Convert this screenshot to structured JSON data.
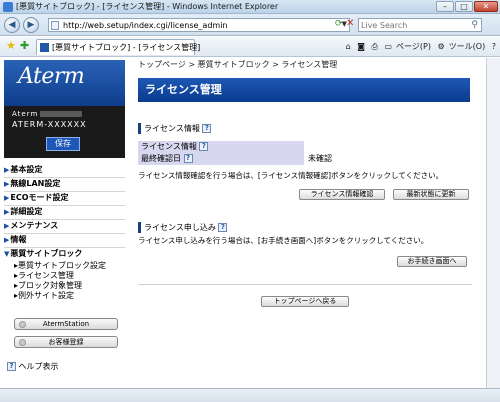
{
  "window": {
    "title": "[悪質サイトブロック] - [ライセンス管理] - Windows Internet Explorer",
    "min_symbol": "–",
    "max_symbol": "□",
    "close_symbol": "✕"
  },
  "address": {
    "url": "http://web.setup/index.cgi/license_admin",
    "search_placeholder": "Live Search"
  },
  "tab": {
    "label": "[悪質サイトブロック] - [ライセンス管理]"
  },
  "ie_toolbar": {
    "page_label": "ページ(P)",
    "tools_label": "ツール(O)"
  },
  "sidebar": {
    "logo": "Aterm",
    "model_prefix": "Aterm",
    "model_name": "ATERM-XXXXXX",
    "save_label": "保存",
    "menu": [
      {
        "label": "基本設定"
      },
      {
        "label": "無線LAN設定"
      },
      {
        "label": "ECOモード設定"
      },
      {
        "label": "詳細設定"
      },
      {
        "label": "メンテナンス"
      },
      {
        "label": "情報"
      },
      {
        "label": "悪質サイトブロック"
      }
    ],
    "submenu": [
      {
        "label": "悪質サイトブロック設定"
      },
      {
        "label": "ライセンス管理"
      },
      {
        "label": "ブロック対象管理"
      },
      {
        "label": "例外サイト設定"
      }
    ],
    "aterm_station_label": "AtermStation",
    "register_label": "お客様登録",
    "help_label": "ヘルプ表示"
  },
  "main": {
    "breadcrumb": "トップページ > 悪質サイトブロック > ライセンス管理",
    "title": "ライセンス管理",
    "license_section": "ライセンス情報",
    "rows": [
      {
        "label": "ライセンス情報",
        "value": ""
      },
      {
        "label": "最終確認日",
        "value": "未確認"
      }
    ],
    "license_desc": "ライセンス情報確認を行う場合は、[ライセンス情報確認]ボタンをクリックしてください。",
    "btn_check": "ライセンス情報確認",
    "btn_refresh": "最新状態に更新",
    "apply_section": "ライセンス申し込み",
    "apply_desc": "ライセンス申し込みを行う場合は、[お手続き画面へ]ボタンをクリックしてください。",
    "btn_apply": "お手続き画面へ",
    "btn_top": "トップページへ戻る"
  }
}
